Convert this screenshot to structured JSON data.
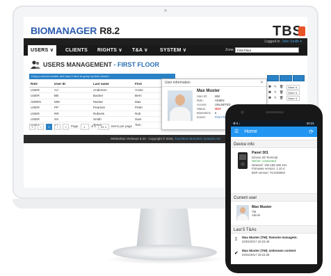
{
  "app": {
    "brand_main": "BIOMANAGER",
    "brand_version": "R8.2",
    "company_logo": "TBS",
    "logged_in_prefix": "Logged in:",
    "logged_in_user": "John Smith ▾"
  },
  "menu": [
    {
      "label": "USERS ∨"
    },
    {
      "label": "CLIENTS"
    },
    {
      "label": "RIGHTS ∨"
    },
    {
      "label": "T&A ∨"
    },
    {
      "label": "SYSTEM ∨"
    }
  ],
  "zone": {
    "label": "Zone:",
    "value": "First Floor"
  },
  "page": {
    "title": "USERS MANAGEMENT",
    "subtitle": "- FIRST FLOOR"
  },
  "group_hint": "Drag a column header and drop it here to group by that column",
  "table": {
    "headers": [
      "Role",
      "User ID",
      "Last name",
      "First"
    ],
    "rows": [
      [
        "USER",
        "AA",
        "Anderson",
        "Annie"
      ],
      [
        "USER",
        "BB",
        "Backer",
        "Bern"
      ],
      [
        "ADMIN",
        "MM",
        "Muster",
        "Max"
      ],
      [
        "USER",
        "PP",
        "Pearson",
        "Peter"
      ],
      [
        "USER",
        "RR",
        "Roberts",
        "Rob"
      ],
      [
        "USER",
        "SS",
        "Smith",
        "Sam"
      ],
      [
        "USER",
        "TT",
        "Tester",
        "Tom"
      ]
    ]
  },
  "pager": {
    "current": "1",
    "page_label": "Page",
    "page_value": "1",
    "of_label": "of 1",
    "per_page": "25 ∨",
    "items_label": "Items per page"
  },
  "popup": {
    "title": "User information",
    "name": "Max Muster",
    "fields": [
      {
        "k": "User ID:",
        "v": "MM"
      },
      {
        "k": "Role:",
        "v": "ADMIN"
      },
      {
        "k": "Access:",
        "v": "UNLIMITED"
      },
      {
        "k": "Status:",
        "v": "OUT"
      },
      {
        "k": "Biometrics:",
        "v": "6"
      },
      {
        "k": "Zones:",
        "v": "First Floor"
      }
    ]
  },
  "actions": {
    "more_label": "More ∨"
  },
  "footer": {
    "text": "WebEdition Release 8.20 - Copyright © 2016,",
    "link": "Touchless Biometric Systems AG"
  },
  "phone": {
    "status_left": "⚙ ℹ ↓",
    "status_right": "20:21",
    "app_title": "Home",
    "device_section": "Device info",
    "device_name": "Panel 301",
    "device_type": "Device 2D Terminal",
    "device_status": "Server: connected",
    "device_network": "Network: 192.168.180.101",
    "device_firmware": "Firmware version: 1.10.4",
    "device_bsp": "BSP version: TCO400DS",
    "user_section": "Current user",
    "user_name": "Max Muster",
    "user_id": "TM",
    "user_role": "Admin",
    "ta_section": "Last 5 T&As",
    "ta_items": [
      {
        "text": "Max Muster (TM): Remote managem.",
        "date": "02/02/2017 20:23:46"
      },
      {
        "text": "Max Muster (TM): Unknown context",
        "date": "02/02/2017 20:23:36"
      }
    ]
  },
  "colors": {
    "accent": "#2a82c6",
    "brand": "#2a5bb0",
    "logo_accent": "#e8542a",
    "phone_bar": "#2196f3"
  }
}
